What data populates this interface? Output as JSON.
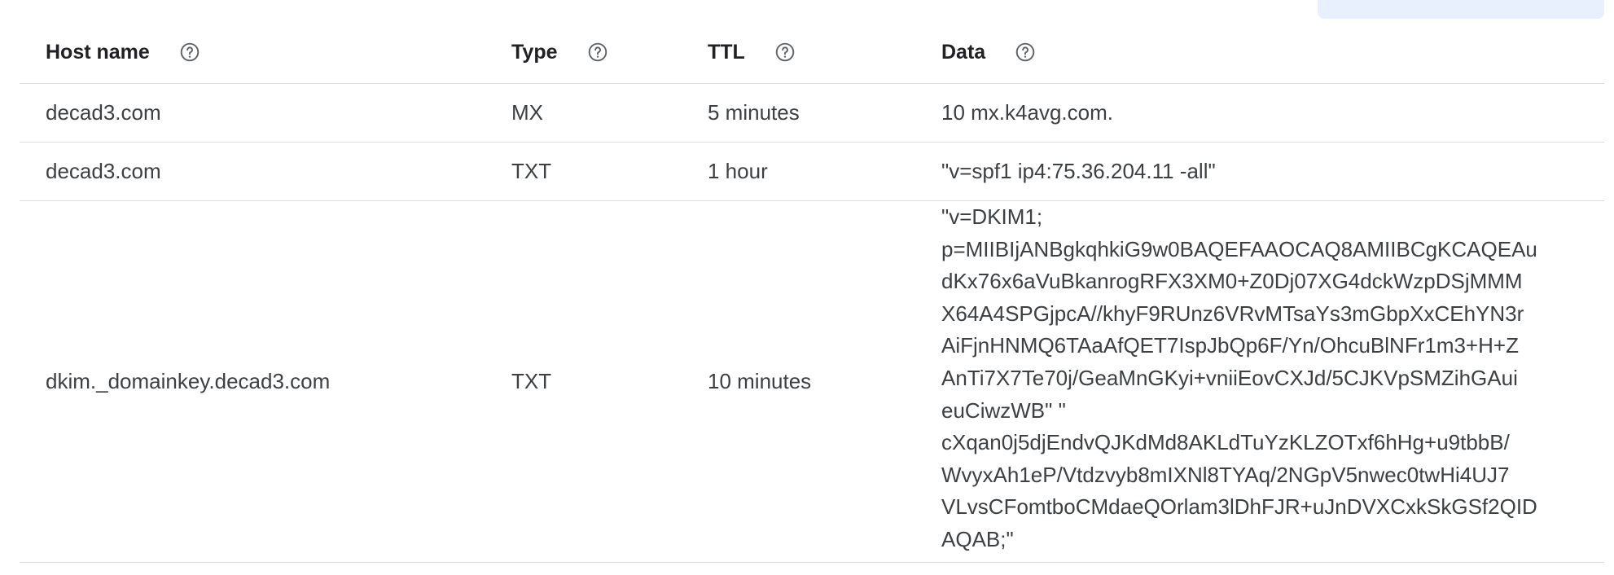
{
  "table": {
    "headers": {
      "host_name": "Host name",
      "type": "Type",
      "ttl": "TTL",
      "data": "Data"
    },
    "help_icon": "help-circle-icon",
    "rows": [
      {
        "host": "decad3.com",
        "type": "MX",
        "ttl": "5 minutes",
        "data": "10 mx.k4avg.com."
      },
      {
        "host": "decad3.com",
        "type": "TXT",
        "ttl": "1 hour",
        "data": "\"v=spf1 ip4:75.36.204.11 -all\""
      },
      {
        "host": "dkim._domainkey.decad3.com",
        "type": "TXT",
        "ttl": "10 minutes",
        "data_lines": [
          "\"v=DKIM1;",
          "p=MIIBIjANBgkqhkiG9w0BAQEFAAOCAQ8AMIIBCgKCAQEAu",
          "dKx76x6aVuBkanrogRFX3XM0+Z0Dj07XG4dckWzpDSjMMM",
          "X64A4SPGjpcA//khyF9RUnz6VRvMTsaYs3mGbpXxCEhYN3r",
          "AiFjnHNMQ6TAaAfQET7IspJbQp6F/Yn/OhcuBlNFr1m3+H+Z",
          "AnTi7X7Te70j/GeaMnGKyi+vniiEovCXJd/5CJKVpSMZihGAui",
          "euCiwzWB\" \"",
          "cXqan0j5djEndvQJKdMd8AKLdTuYzKLZOTxf6hHg+u9tbbB/",
          "WvyxAh1eP/Vtdzvyb8mIXNl8TYAq/2NGpV5nwec0twHi4UJ7",
          "VLvsCFomtboCMdaeQOrlam3lDhFJR+uJnDVXCxkSkGSf2QID",
          "AQAB;\""
        ]
      }
    ]
  }
}
